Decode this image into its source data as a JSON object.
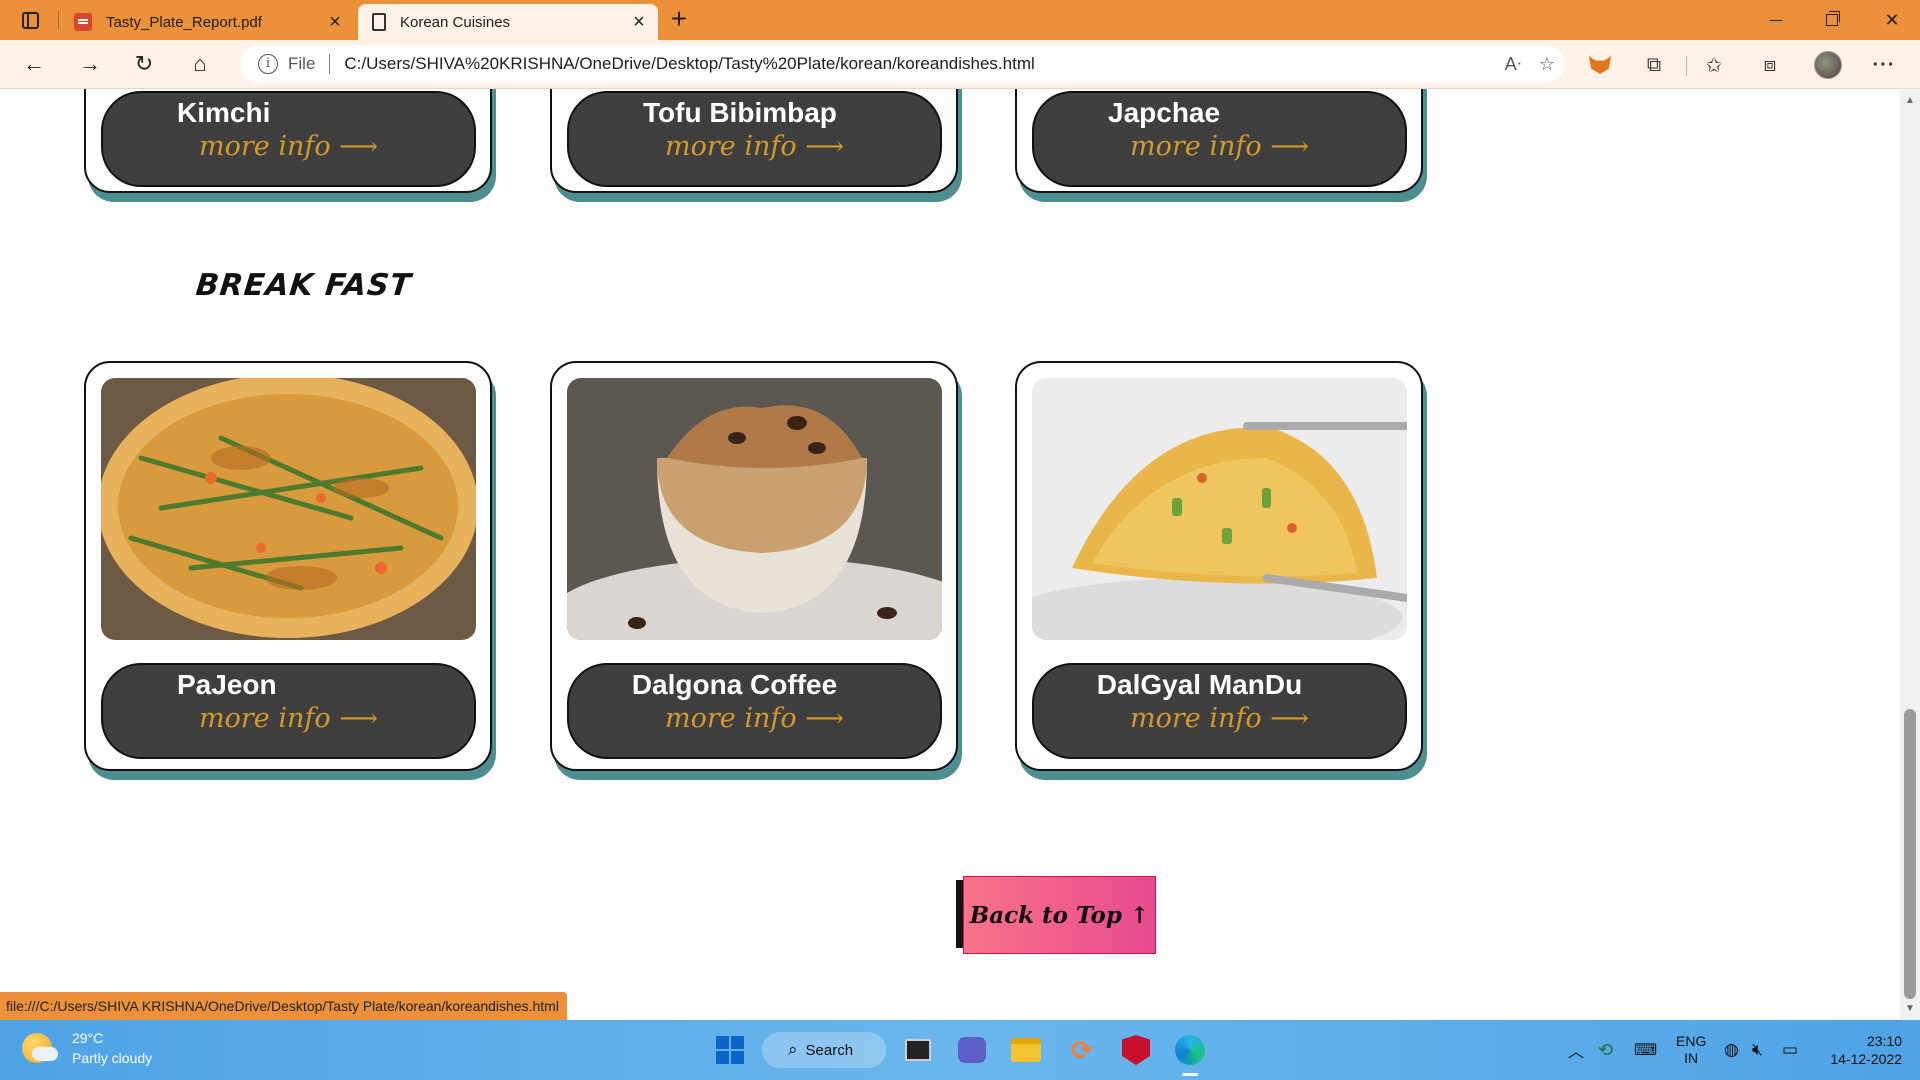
{
  "browser": {
    "tabs": [
      {
        "label": "Tasty_Plate_Report.pdf",
        "active": false
      },
      {
        "label": "Korean Cuisines",
        "active": true
      }
    ],
    "address": {
      "scheme": "File",
      "url": "C:/Users/SHIVA%20KRISHNA/OneDrive/Desktop/Tasty%20Plate/korean/koreandishes.html"
    },
    "status_link": "file:///C:/Users/SHIVA KRISHNA/OneDrive/Desktop/Tasty Plate/korean/koreandishes.html"
  },
  "page": {
    "top_cards": [
      {
        "name": "Kimchi",
        "link": "more info ⟶"
      },
      {
        "name": "Tofu Bibimbap",
        "link": "more info ⟶"
      },
      {
        "name": "Japchae",
        "link": "more info ⟶"
      }
    ],
    "breakfast": {
      "title": "BREAK FAST",
      "cards": [
        {
          "name": "PaJeon",
          "link": "more info ⟶"
        },
        {
          "name": "Dalgona Coffee",
          "link": "more info ⟶"
        },
        {
          "name": "DalGyal ManDu",
          "link": "more info ⟶"
        }
      ]
    },
    "back_to_top": "Back to Top ↑"
  },
  "taskbar": {
    "weather_temp": "29°C",
    "weather_desc": "Partly cloudy",
    "search_label": "Search",
    "lang_top": "ENG",
    "lang_bottom": "IN",
    "time": "23:10",
    "date": "14-12-2022"
  },
  "colors": {
    "accent_orange": "#ec913a",
    "card_shadow": "#4d8f90",
    "info_panel": "#3f3f3f",
    "more_info_text": "#d49a2c",
    "back_top_gradient_start": "#f9738a",
    "back_top_gradient_end": "#e84a8f"
  }
}
